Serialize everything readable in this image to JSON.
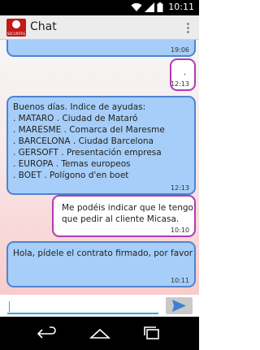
{
  "status_bar": {
    "time": "10:11",
    "icons": [
      "wifi-icon",
      "signal-icon",
      "battery-icon"
    ]
  },
  "action_bar": {
    "title": "Chat",
    "logo_text": "SECURITAS",
    "logo_color": "#c31818",
    "overflow_icon": "overflow-menu-icon"
  },
  "messages": [
    {
      "direction": "outgoing",
      "text": "",
      "time": "19:06"
    },
    {
      "direction": "incoming",
      "text": ".",
      "time": "12:13"
    },
    {
      "direction": "outgoing",
      "text": "Buenos días. Indice de ayudas:\n. MATARO . Ciudad de Mataró\n. MARESME . Comarca del Maresme\n. BARCELONA . Ciudad Barcelona\n. GERSOFT . Presentación empresa\n. EUROPA . Temas europeos\n. BOET . Polígono d'en boet",
      "time": "12:13"
    },
    {
      "direction": "incoming",
      "text": "Me podéis indicar que le tengo que pedir al cliente Micasa.",
      "time": "10:10"
    },
    {
      "direction": "outgoing",
      "text": "Hola, pídele el contrato firmado, por favor",
      "time": "10:11"
    }
  ],
  "input": {
    "value": "",
    "placeholder": ""
  },
  "send_button": {
    "icon": "send-icon",
    "color": "#3f80d6"
  },
  "nav_bar": {
    "icons": [
      "back-icon",
      "home-icon",
      "recents-icon"
    ]
  },
  "colors": {
    "outgoing_bubble": "#a6cef8",
    "outgoing_border": "#4f84d0",
    "incoming_bubble": "#ffffff",
    "incoming_border": "#b03cb0",
    "accent": "#36a9d8"
  }
}
